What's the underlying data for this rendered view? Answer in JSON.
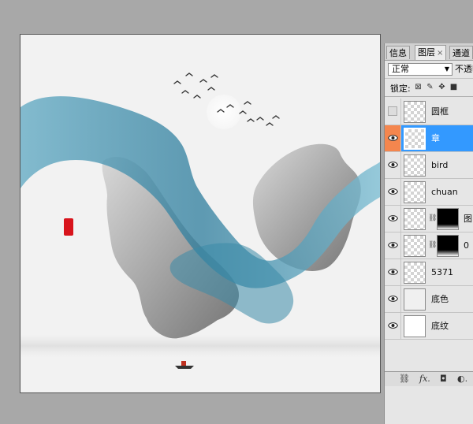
{
  "tabs": [
    {
      "label": "信息"
    },
    {
      "label": "图层",
      "close": "×"
    },
    {
      "label": "通道"
    }
  ],
  "blend_mode": "正常",
  "opacity_label": "不透明",
  "lock_label": "锁定:",
  "layers": [
    {
      "name": "圆框",
      "visible": false
    },
    {
      "name": "章",
      "visible": true,
      "selected": true
    },
    {
      "name": "bird",
      "visible": true
    },
    {
      "name": "chuan",
      "visible": true
    },
    {
      "name": "图",
      "visible": true,
      "mask": true
    },
    {
      "name": "0",
      "visible": true,
      "mask": true
    },
    {
      "name": "5371",
      "visible": true
    },
    {
      "name": "底色",
      "visible": true
    },
    {
      "name": "底纹",
      "visible": true
    }
  ],
  "colors": {
    "ink_blue": "#2f7f9e",
    "ink_gray": "#8c8c8c",
    "seal_red": "#d8141c",
    "selected_row": "#3399ff",
    "selected_eye": "#f4864e"
  }
}
